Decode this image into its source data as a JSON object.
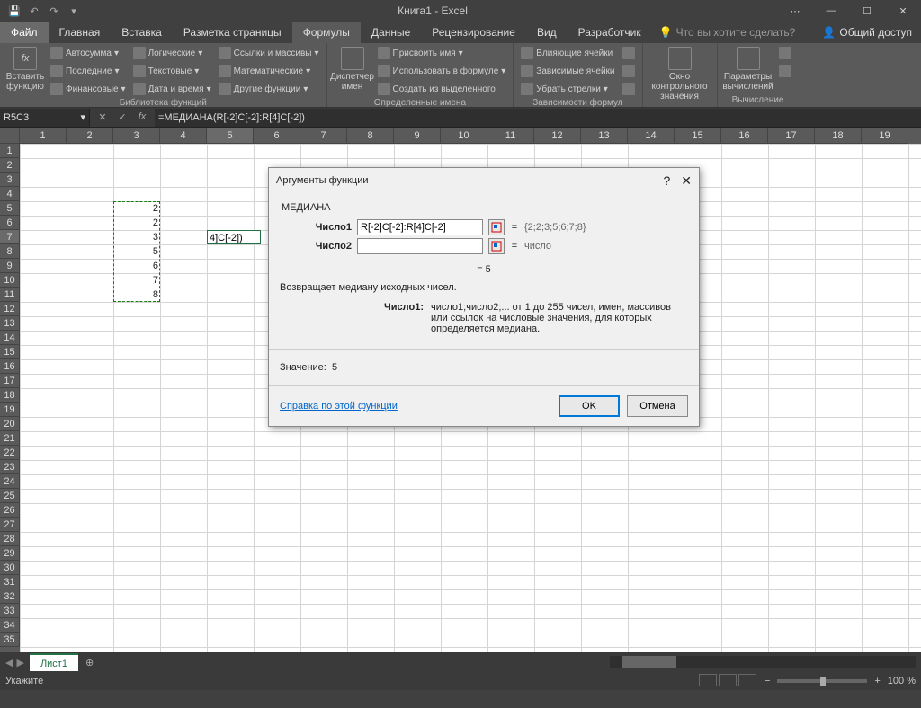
{
  "title": "Книга1 - Excel",
  "tabs": {
    "file": "Файл",
    "home": "Главная",
    "insert": "Вставка",
    "layout": "Разметка страницы",
    "formulas": "Формулы",
    "data": "Данные",
    "review": "Рецензирование",
    "view": "Вид",
    "dev": "Разработчик"
  },
  "tellme": "Что вы хотите сделать?",
  "share": "Общий доступ",
  "ribbon": {
    "insertfn": {
      "label": "Вставить\nфункцию"
    },
    "lib": {
      "autosum": "Автосумма",
      "logical": "Логические",
      "lookup": "Ссылки и массивы",
      "recent": "Последние",
      "text": "Текстовые",
      "math": "Математические",
      "financial": "Финансовые",
      "datetime": "Дата и время",
      "more": "Другие функции",
      "label": "Библиотека функций"
    },
    "names": {
      "mgr": "Диспетчер\nимен",
      "define": "Присвоить имя",
      "use": "Использовать в формуле",
      "create": "Создать из выделенного",
      "label": "Определенные имена"
    },
    "audit": {
      "prec": "Влияющие ячейки",
      "dep": "Зависимые ячейки",
      "remove": "Убрать стрелки",
      "label": "Зависимости формул"
    },
    "watch": "Окно контрольного\nзначения",
    "calc": {
      "opts": "Параметры\nвычислений",
      "label": "Вычисление"
    }
  },
  "namebox": "R5C3",
  "formula": "=МЕДИАНА(R[-2]C[-2]:R[4]C[-2])",
  "columns": [
    "1",
    "2",
    "3",
    "4",
    "5",
    "6",
    "7",
    "8",
    "9",
    "10",
    "11",
    "12",
    "13",
    "14",
    "15",
    "16",
    "17",
    "18",
    "19"
  ],
  "rows_count": 35,
  "data_cells": {
    "r5": "2",
    "r6": "2",
    "r7": "3",
    "r8": "5",
    "r9": "6",
    "r10": "7",
    "r11": "8"
  },
  "active_cell_text": "4]C[-2])",
  "sheet": "Лист1",
  "status": {
    "mode": "Укажите",
    "zoom": "100 %"
  },
  "dialog": {
    "title": "Аргументы функции",
    "func": "МЕДИАНА",
    "arg1_label": "Число1",
    "arg1_value": "R[-2]C[-2]:R[4]C[-2]",
    "arg1_result": "{2;2;3;5;6;7;8}",
    "arg2_label": "Число2",
    "arg2_value": "",
    "arg2_result": "число",
    "eq": "=",
    "calc": "=   5",
    "desc": "Возвращает медиану исходных чисел.",
    "argdesc_k": "Число1:",
    "argdesc_v": "число1;число2;... от 1 до 255 чисел, имен, массивов или ссылок на числовые значения, для которых определяется медиана.",
    "result_label": "Значение:",
    "result_value": "5",
    "help": "Справка по этой функции",
    "ok": "OK",
    "cancel": "Отмена"
  }
}
